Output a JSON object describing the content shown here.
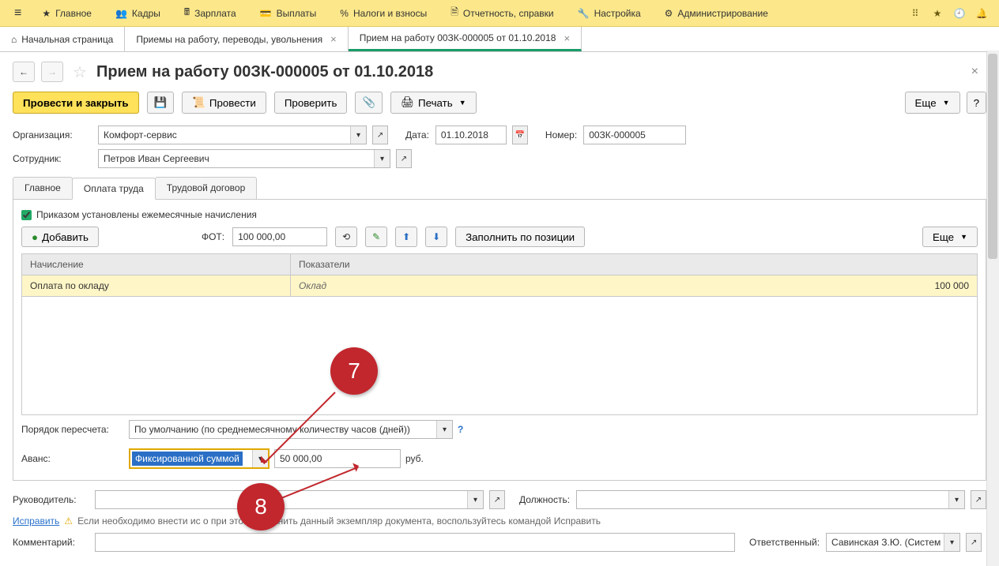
{
  "topmenu": {
    "main": "Главное",
    "kadry": "Кадры",
    "zarplata": "Зарплата",
    "vyplaty": "Выплаты",
    "nalogi": "Налоги и взносы",
    "otchet": "Отчетность, справки",
    "nastroika": "Настройка",
    "admin": "Администрирование"
  },
  "tabs": {
    "home": "Начальная страница",
    "t1": "Приемы на работу, переводы, увольнения",
    "t2": "Прием на работу 00ЗК-000005 от 01.10.2018"
  },
  "page": {
    "title": "Прием на работу 00ЗК-000005 от 01.10.2018"
  },
  "toolbar": {
    "provesti_zakryt": "Провести и закрыть",
    "provesti": "Провести",
    "proverit": "Проверить",
    "pechat": "Печать",
    "eshche": "Еще",
    "help": "?"
  },
  "form": {
    "org_label": "Организация:",
    "org_value": "Комфорт-сервис",
    "date_label": "Дата:",
    "date_value": "01.10.2018",
    "num_label": "Номер:",
    "num_value": "00ЗК-000005",
    "emp_label": "Сотрудник:",
    "emp_value": "Петров Иван Сергеевич"
  },
  "doctabs": {
    "main": "Главное",
    "oplata": "Оплата труда",
    "dogovor": "Трудовой договор"
  },
  "panel": {
    "checkbox_label": "Приказом установлены ежемесячные начисления",
    "add": "Добавить",
    "fot_label": "ФОТ:",
    "fot_value": "100 000,00",
    "fill_by_position": "Заполнить по позиции",
    "eshche": "Еще",
    "th_accrual": "Начисление",
    "th_indicators": "Показатели",
    "row_accrual": "Оплата по окладу",
    "row_indicator": "Оклад",
    "row_amount": "100 000"
  },
  "lower": {
    "recalc_label": "Порядок пересчета:",
    "recalc_value": "По умолчанию (по среднемесячному количеству часов (дней))",
    "avans_label": "Аванс:",
    "avans_mode": "Фиксированной суммой",
    "avans_amount": "50 000,00",
    "avans_unit": "руб."
  },
  "bottom": {
    "ruk_label": "Руководитель:",
    "dolzh_label": "Должность:",
    "ispravit": "Исправить",
    "warn_text": "Если необходимо внести ис                          о при этом сохранить данный экземпляр документа, воспользуйтесь командой Исправить",
    "comment_label": "Комментарий:",
    "resp_label": "Ответственный:",
    "resp_value": "Савинская З.Ю. (Систем"
  },
  "anno": {
    "seven": "7",
    "eight": "8"
  }
}
